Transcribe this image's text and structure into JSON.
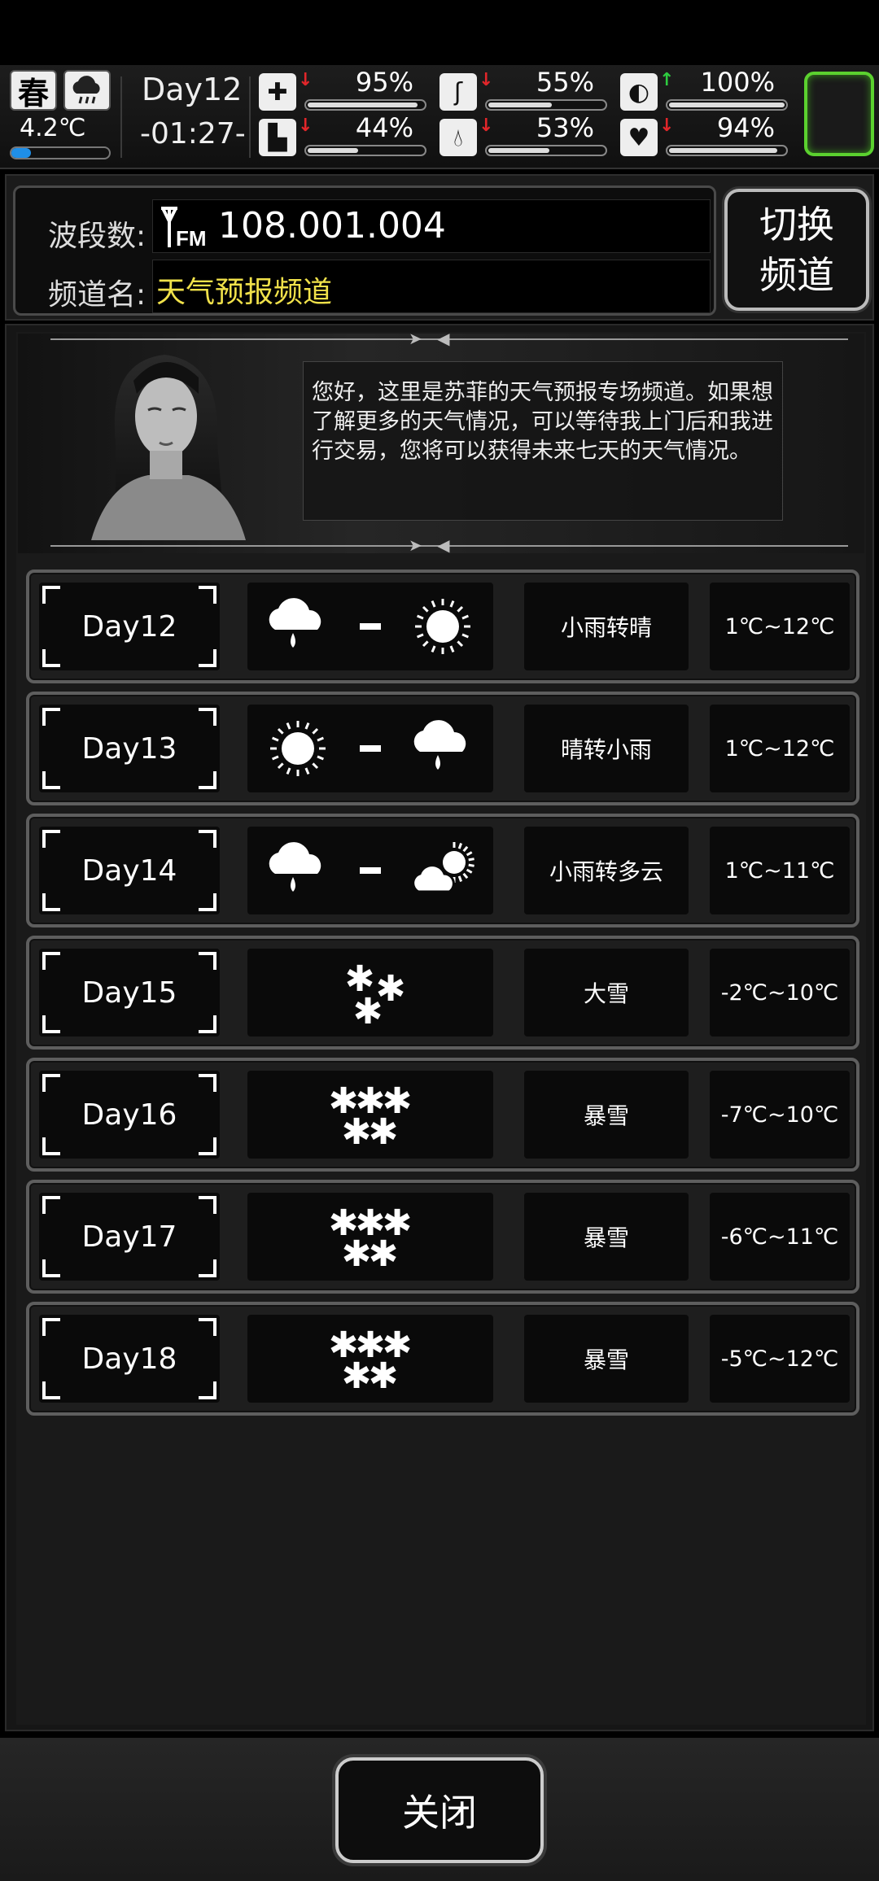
{
  "status": {
    "season": "春",
    "weather_icon": "cloud-rain-icon",
    "temperature": "4.2℃",
    "temperature_level": 0.2,
    "day": "Day12",
    "time": "-01:27-",
    "stats": [
      {
        "name": "health",
        "icon": "medkit-icon",
        "trend": "down",
        "value": "95%",
        "level": 0.95
      },
      {
        "name": "hunger",
        "icon": "stomach-icon",
        "trend": "down",
        "value": "55%",
        "level": 0.55
      },
      {
        "name": "medicine",
        "icon": "pill-icon",
        "trend": "up",
        "value": "100%",
        "level": 1.0
      },
      {
        "name": "stamina",
        "icon": "boot-icon",
        "trend": "down",
        "value": "44%",
        "level": 0.44
      },
      {
        "name": "thirst",
        "icon": "water-drop-icon",
        "trend": "down",
        "value": "53%",
        "level": 0.53
      },
      {
        "name": "mood",
        "icon": "heart-icon",
        "trend": "down",
        "value": "94%",
        "level": 0.94
      }
    ],
    "accent_color": "#5bd12f"
  },
  "radio": {
    "band_label": "波段数:",
    "band_icon_text": "FM",
    "frequency": "108.001.004",
    "channel_label": "频道名:",
    "channel_name": "天气预报频道",
    "channel_name_color": "#f0e14a",
    "switch_line1": "切换",
    "switch_line2": "频道"
  },
  "dialog": {
    "text": "您好，这里是苏菲的天气预报专场频道。如果想了解更多的天气情况，可以等待我上门后和我进行交易，您将可以获得未来七天的天气情况。"
  },
  "forecast": [
    {
      "day": "Day12",
      "icons": [
        "rain",
        "sun"
      ],
      "desc": "小雨转晴",
      "temp": "1℃~12℃"
    },
    {
      "day": "Day13",
      "icons": [
        "sun",
        "rain"
      ],
      "desc": "晴转小雨",
      "temp": "1℃~12℃"
    },
    {
      "day": "Day14",
      "icons": [
        "rain",
        "partly-cloudy"
      ],
      "desc": "小雨转多云",
      "temp": "1℃~11℃"
    },
    {
      "day": "Day15",
      "icons": [
        "heavy-snow"
      ],
      "desc": "大雪",
      "temp": "-2℃~10℃"
    },
    {
      "day": "Day16",
      "icons": [
        "blizzard"
      ],
      "desc": "暴雪",
      "temp": "-7℃~10℃"
    },
    {
      "day": "Day17",
      "icons": [
        "blizzard"
      ],
      "desc": "暴雪",
      "temp": "-6℃~11℃"
    },
    {
      "day": "Day18",
      "icons": [
        "blizzard"
      ],
      "desc": "暴雪",
      "temp": "-5℃~12℃"
    }
  ],
  "close_label": "关闭"
}
